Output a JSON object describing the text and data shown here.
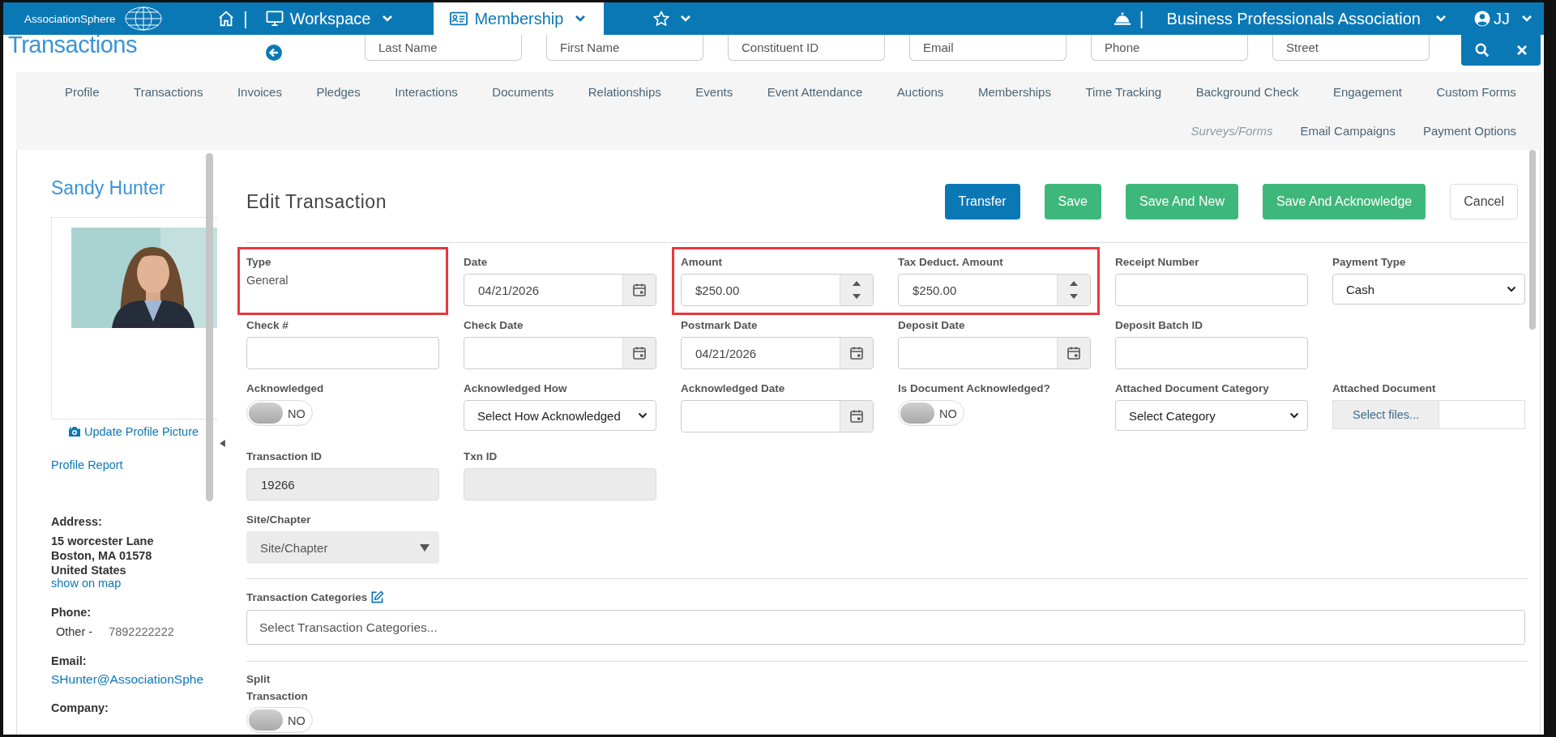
{
  "top_bar": {
    "logo": "AssociationSphere",
    "home_separator": "|",
    "menus": [
      {
        "label": "Workspace",
        "selected": false,
        "kind": "desktop"
      },
      {
        "label": "Membership",
        "selected": true,
        "kind": "card"
      }
    ],
    "bell_separator": "|",
    "organization": "Business Professionals Association",
    "user": "JJ"
  },
  "page_title": "Transactions",
  "search_fields": [
    {
      "placeholder": "Last Name"
    },
    {
      "placeholder": "First Name"
    },
    {
      "placeholder": "Constituent ID"
    },
    {
      "placeholder": "Email"
    },
    {
      "placeholder": "Phone"
    },
    {
      "placeholder": "Street"
    }
  ],
  "tab_rows": [
    [
      {
        "label": "Profile",
        "disabled": false
      },
      {
        "label": "Transactions",
        "disabled": false
      },
      {
        "label": "Invoices",
        "disabled": false
      },
      {
        "label": "Pledges",
        "disabled": false
      },
      {
        "label": "Interactions",
        "disabled": false
      },
      {
        "label": "Documents",
        "disabled": false
      },
      {
        "label": "Relationships",
        "disabled": false
      },
      {
        "label": "Events",
        "disabled": false
      },
      {
        "label": "Event Attendance",
        "disabled": false
      },
      {
        "label": "Auctions",
        "disabled": false
      },
      {
        "label": "Memberships",
        "disabled": false
      },
      {
        "label": "Time Tracking",
        "disabled": false
      },
      {
        "label": "Background Check",
        "disabled": false
      },
      {
        "label": "Engagement",
        "disabled": false
      },
      {
        "label": "Custom Forms",
        "disabled": false
      }
    ],
    [
      {
        "label": "Surveys/Forms",
        "disabled": true
      },
      {
        "label": "Email Campaigns",
        "disabled": false
      },
      {
        "label": "Payment Options",
        "disabled": false
      }
    ]
  ],
  "profile": {
    "name": "Sandy Hunter",
    "update_picture": "Update Profile Picture",
    "report": "Profile Report",
    "address": {
      "label": "Address:",
      "lines": [
        "15 worcester Lane",
        "Boston, MA 01578",
        "United States"
      ],
      "map_link": "show on map"
    },
    "phone": {
      "label": "Phone:",
      "type": "Other -",
      "number": "7892222222"
    },
    "email": {
      "label": "Email:",
      "value": "SHunter@AssociationSphe"
    },
    "company": {
      "label": "Company:"
    }
  },
  "form": {
    "title": "Edit Transaction",
    "buttons": [
      {
        "label": "Transfer",
        "kind": "primary"
      },
      {
        "label": "Save",
        "kind": "success"
      },
      {
        "label": "Save And New",
        "kind": "success"
      },
      {
        "label": "Save And Acknowledge",
        "kind": "success"
      },
      {
        "label": "Cancel",
        "kind": "default"
      }
    ],
    "rows": [
      {
        "fields": [
          {
            "label": "Type",
            "kind": "static",
            "value": "General",
            "highlighted": true
          },
          {
            "label": "Date",
            "kind": "date",
            "value": "04/21/2026",
            "highlighted": false
          },
          {
            "label": "Amount",
            "kind": "number",
            "value": "$250.00",
            "highlighted": true
          },
          {
            "label": "Tax Deduct. Amount",
            "kind": "number",
            "value": "$250.00",
            "highlighted": true
          },
          {
            "label": "Receipt Number",
            "kind": "text",
            "highlighted": false
          },
          {
            "label": "Payment Type",
            "kind": "select",
            "value": "Cash",
            "highlighted": false
          }
        ]
      },
      {
        "fields": [
          {
            "label": "Check #",
            "kind": "text",
            "highlighted": false
          },
          {
            "label": "Check Date",
            "kind": "date",
            "highlighted": false
          },
          {
            "label": "Postmark Date",
            "kind": "date",
            "value": "04/21/2026",
            "highlighted": false
          },
          {
            "label": "Deposit Date",
            "kind": "date",
            "highlighted": false
          },
          {
            "label": "Deposit Batch ID",
            "kind": "text",
            "highlighted": false
          }
        ]
      },
      {
        "fields": [
          {
            "label": "Acknowledged",
            "kind": "toggle",
            "on": false,
            "value": "NO",
            "highlighted": false
          },
          {
            "label": "Acknowledged How",
            "kind": "select",
            "value": "Select How Acknowledged",
            "highlighted": false
          },
          {
            "label": "Acknowledged Date",
            "kind": "date",
            "highlighted": false
          },
          {
            "label": "Is Document Acknowledged?",
            "kind": "toggle",
            "on": false,
            "value": "NO",
            "highlighted": false
          },
          {
            "label": "Attached Document Category",
            "kind": "select",
            "value": "Select Category",
            "highlighted": false
          },
          {
            "label": "Attached Document",
            "kind": "file",
            "value": "Select files...",
            "highlighted": false
          }
        ]
      },
      {
        "fields": [
          {
            "label": "Transaction ID",
            "kind": "readonly",
            "value": "19266",
            "highlighted": false
          },
          {
            "label": "Txn ID",
            "kind": "readonly",
            "highlighted": false
          }
        ]
      },
      {
        "fields": [
          {
            "label": "Site/Chapter",
            "kind": "dropdown",
            "value": "Site/Chapter",
            "highlighted": false
          }
        ]
      }
    ],
    "categories": {
      "label": "Transaction Categories",
      "placeholder": "Select Transaction Categories..."
    },
    "split": {
      "label": "Split Transaction",
      "on": false,
      "value": "NO"
    }
  }
}
